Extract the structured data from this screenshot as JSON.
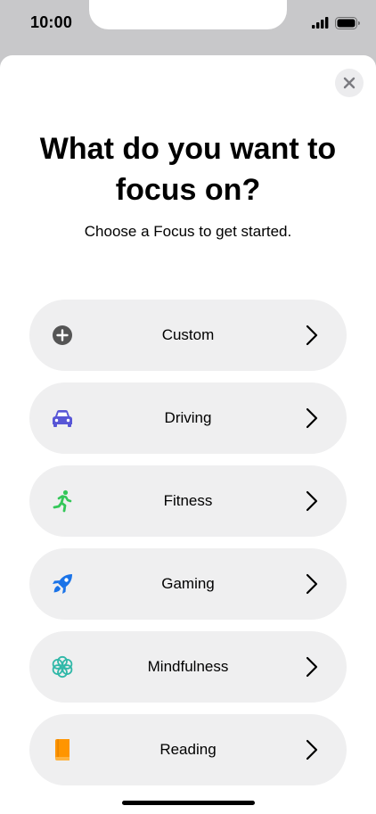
{
  "status_bar": {
    "time": "10:00"
  },
  "header": {
    "title": "What do you want to focus on?",
    "subtitle": "Choose a Focus to get started."
  },
  "options": [
    {
      "label": "Custom",
      "icon": "plus-circle-icon",
      "color": "#555555"
    },
    {
      "label": "Driving",
      "icon": "car-icon",
      "color": "#5856d6"
    },
    {
      "label": "Fitness",
      "icon": "running-figure-icon",
      "color": "#34c759"
    },
    {
      "label": "Gaming",
      "icon": "rocket-icon",
      "color": "#1a73e8"
    },
    {
      "label": "Mindfulness",
      "icon": "flower-icon",
      "color": "#30b8a8"
    },
    {
      "label": "Reading",
      "icon": "book-icon",
      "color": "#ff9500"
    }
  ]
}
